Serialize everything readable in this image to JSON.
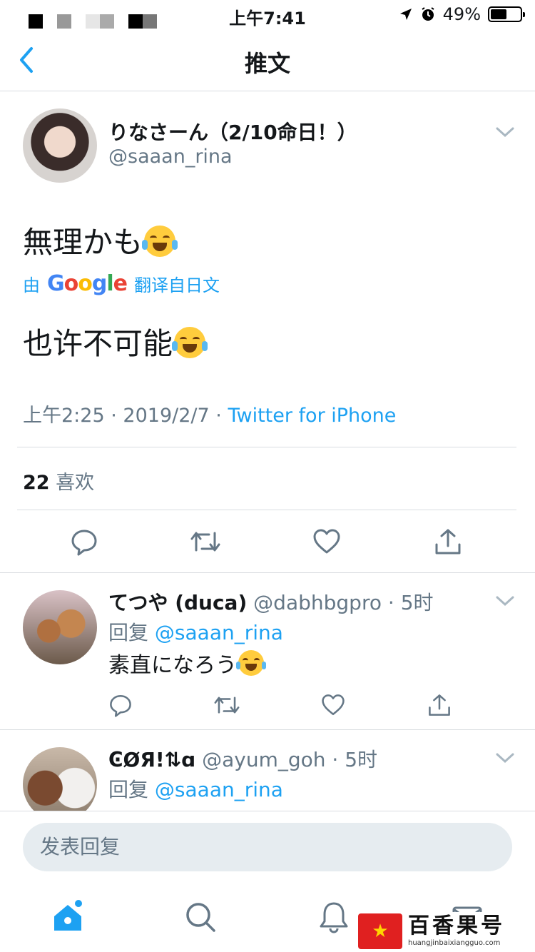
{
  "status_bar": {
    "time": "上午7:41",
    "battery": "49%",
    "battery_level": 0.49
  },
  "nav": {
    "title": "推文"
  },
  "tweet": {
    "display_name": "りなさーん（2/10命日！）",
    "handle": "@saaan_rina",
    "text": "無理かも",
    "translate_prefix": "由",
    "translate_brand": "Google",
    "translate_suffix": "翻译自日文",
    "translated_text": "也许不可能",
    "time": "上午2:25",
    "date": "2019/2/7",
    "separator": "·",
    "source": "Twitter for iPhone",
    "like_count": "22",
    "like_label": "喜欢"
  },
  "replies": [
    {
      "name": "てつや (duca)",
      "handle": "@dabhbgpro",
      "time": "5时",
      "reply_prefix": "回复",
      "reply_to": "@saaan_rina",
      "text": "素直になろう"
    },
    {
      "name": "ϾØЯ!⇅ɑ",
      "handle": "@ayum_goh",
      "time": "5时",
      "reply_prefix": "回复",
      "reply_to": "@saaan_rina",
      "text": ""
    }
  ],
  "compose": {
    "placeholder": "发表回复"
  },
  "icons": {
    "reply": "reply-icon",
    "retweet": "retweet-icon",
    "like": "heart-icon",
    "share": "share-icon",
    "home": "home-icon",
    "search": "search-icon",
    "notifications": "bell-icon",
    "messages": "mail-icon"
  },
  "watermark": {
    "title": "百香果号",
    "url": "huangjinbaixiangguo.com"
  },
  "colors": {
    "accent": "#1da1f2",
    "muted": "#657786",
    "text": "#14171a",
    "divider": "#d9dde1"
  }
}
